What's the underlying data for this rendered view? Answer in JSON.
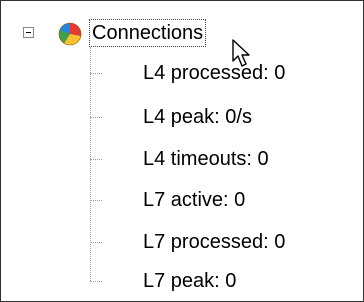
{
  "tree": {
    "root": {
      "label": "Connections",
      "icon": "pie-chart-icon",
      "expanded": true
    },
    "children": [
      {
        "label": "L4 processed: 0"
      },
      {
        "label": "L4 peak: 0/s"
      },
      {
        "label": "L4 timeouts: 0"
      },
      {
        "label": "L7 active: 0"
      },
      {
        "label": "L7 processed: 0"
      },
      {
        "label": "L7 peak: 0"
      }
    ]
  }
}
